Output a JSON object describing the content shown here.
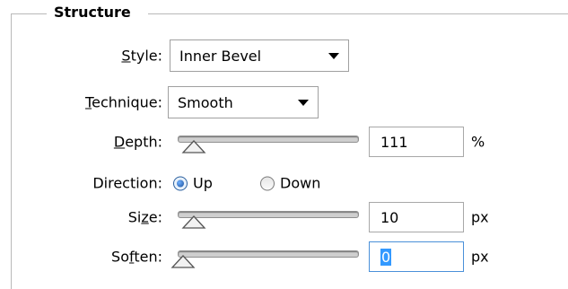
{
  "structure": {
    "title": "Structure",
    "style": {
      "label_pre": "",
      "label_ul": "S",
      "label_post": "tyle:",
      "value": "Inner Bevel"
    },
    "technique": {
      "label_pre": "",
      "label_ul": "T",
      "label_post": "echnique:",
      "value": "Smooth"
    },
    "depth": {
      "label_pre": "",
      "label_ul": "D",
      "label_post": "epth:",
      "value": "111",
      "unit": "%"
    },
    "direction": {
      "label": "Direction:",
      "options": [
        "Up",
        "Down"
      ],
      "selected": "Up"
    },
    "size": {
      "label_pre": "Si",
      "label_ul": "z",
      "label_post": "e:",
      "value": "10",
      "unit": "px"
    },
    "soften": {
      "label_pre": "So",
      "label_ul": "f",
      "label_post": "ten:",
      "value": "0",
      "unit": "px"
    }
  },
  "colors": {
    "accent": "#3399ff",
    "border": "#a0a0a0",
    "group_line": "#b9b9b9"
  },
  "icons": [
    "chevron-down-icon",
    "slider-thumb-icon",
    "radio-icon"
  ]
}
